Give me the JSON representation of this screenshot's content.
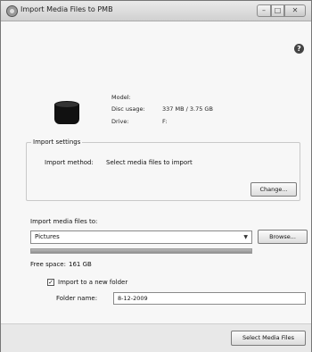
{
  "window": {
    "title": "Import Media Files to PMB",
    "min_glyph": "–",
    "max_glyph": "□",
    "close_glyph": "✕"
  },
  "help_glyph": "?",
  "device": {
    "model_label": "Model:",
    "model_value": "",
    "disc_usage_label": "Disc usage:",
    "disc_usage_value": "337 MB / 3.75 GB",
    "drive_label": "Drive:",
    "drive_value": "F:"
  },
  "import_settings": {
    "group_label": "Import settings",
    "method_label": "Import method:",
    "method_value": "Select media files to import",
    "change_button": "Change..."
  },
  "import_to": {
    "label": "Import media files to:",
    "selected": "Pictures",
    "browse_button": "Browse...",
    "usage_fraction": 1.0,
    "free_space_label": "Free space:",
    "free_space_value": "161 GB"
  },
  "new_folder": {
    "checkbox_label": "Import to a new folder",
    "checked": true,
    "check_glyph": "✓",
    "folder_name_label": "Folder name:",
    "folder_name_value": "8-12-2009"
  },
  "footer": {
    "select_button": "Select Media Files"
  },
  "icons": [
    "app-icon",
    "help-icon",
    "device-icon",
    "dropdown-arrow-icon",
    "checkbox-icon"
  ]
}
